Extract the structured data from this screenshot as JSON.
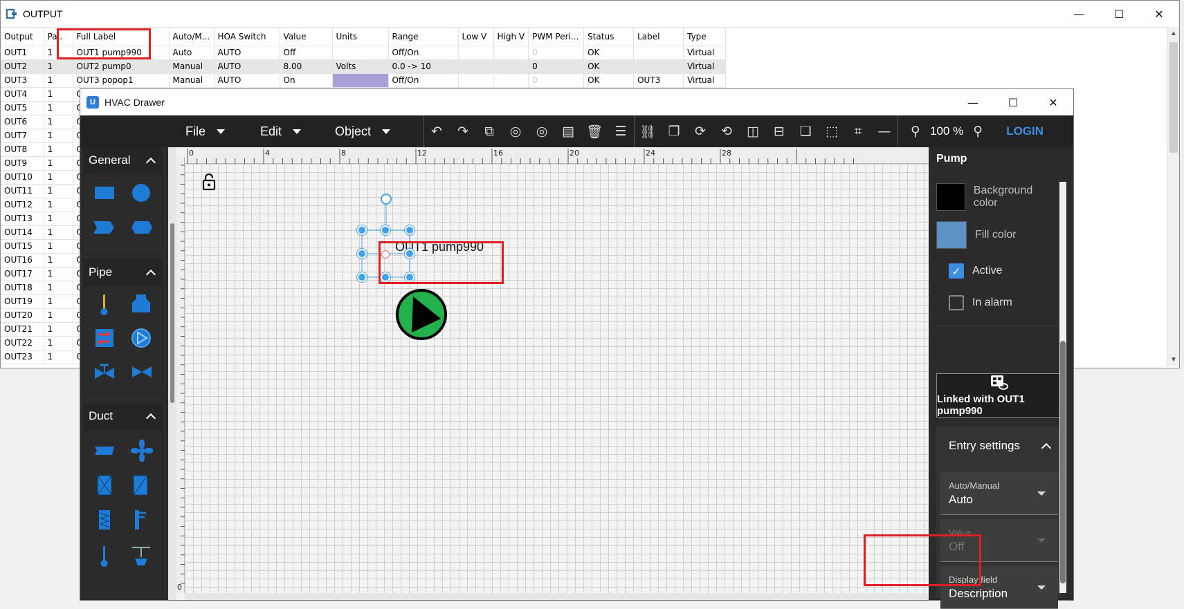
{
  "output_window": {
    "title": "OUTPUT",
    "controls": {
      "minimize": "—",
      "maximize": "☐",
      "close": "✕"
    },
    "columns": [
      "Output",
      "Pa..",
      "Full Label",
      "Auto/M...",
      "HOA Switch",
      "Value",
      "Units",
      "Range",
      "Low V",
      "High V",
      "PWM Peri...",
      "Status",
      "Label",
      "Type"
    ],
    "rows": [
      [
        "OUT1",
        "1",
        "OUT1 pump990",
        "Auto",
        "AUTO",
        "Off",
        "",
        "Off/On",
        "",
        "",
        "0",
        "OK",
        "",
        "Virtual"
      ],
      [
        "OUT2",
        "1",
        "OUT2 pump0",
        "Manual",
        "AUTO",
        "8.00",
        "Volts",
        "0.0 -> 10",
        "",
        "",
        "0",
        "OK",
        "",
        "Virtual"
      ],
      [
        "OUT3",
        "1",
        "OUT3 popop1",
        "Manual",
        "AUTO",
        "On",
        "",
        "Off/On",
        "",
        "",
        "0",
        "OK",
        "OUT3",
        "Virtual"
      ],
      [
        "OUT4",
        "1",
        "O"
      ],
      [
        "OUT5",
        "1",
        "O"
      ],
      [
        "OUT6",
        "1",
        "O"
      ],
      [
        "OUT7",
        "1",
        "O"
      ],
      [
        "OUT8",
        "1",
        "O"
      ],
      [
        "OUT9",
        "1",
        "O"
      ],
      [
        "OUT10",
        "1",
        "O"
      ],
      [
        "OUT11",
        "1",
        "O"
      ],
      [
        "OUT12",
        "1",
        "O"
      ],
      [
        "OUT13",
        "1",
        "O"
      ],
      [
        "OUT14",
        "1",
        "O"
      ],
      [
        "OUT15",
        "1",
        "O"
      ],
      [
        "OUT16",
        "1",
        "O"
      ],
      [
        "OUT17",
        "1",
        "O"
      ],
      [
        "OUT18",
        "1",
        "O"
      ],
      [
        "OUT19",
        "1",
        "O"
      ],
      [
        "OUT20",
        "1",
        "O"
      ],
      [
        "OUT21",
        "1",
        "O"
      ],
      [
        "OUT22",
        "1",
        "O"
      ],
      [
        "OUT23",
        "1",
        "O"
      ]
    ]
  },
  "hvac_window": {
    "title": "HVAC Drawer",
    "app_icon_letter": "U",
    "controls": {
      "minimize": "—",
      "maximize": "☐",
      "close": "✕"
    },
    "menus": [
      "File",
      "Edit",
      "Object"
    ],
    "toolbar_icons": [
      "undo-icon",
      "redo-icon",
      "copy-icon",
      "group-icon",
      "ungroup-icon",
      "duplicate-icon",
      "delete-icon",
      "align-icon",
      "link-icon",
      "paste-icon",
      "rotate-cw-icon",
      "rotate-ccw-icon",
      "flip-horizontal-icon",
      "flip-vertical-icon",
      "bring-front-icon",
      "send-back-icon",
      "crop-icon",
      "line-icon"
    ],
    "zoom": "100 %",
    "login": "LOGIN",
    "palette": {
      "sections": [
        "General",
        "Pipe",
        "Duct"
      ]
    },
    "ruler": {
      "h_labels": [
        "0",
        "4",
        "8",
        "12",
        "16",
        "20",
        "24",
        "28"
      ],
      "v_label": "0"
    },
    "canvas": {
      "pump_label": "OUT1 pump990"
    },
    "properties": {
      "title": "Pump",
      "background_color_label": "Background color",
      "background_color": "#000000",
      "fill_color_label": "Fill color",
      "fill_color": "#5d93c4",
      "active_label": "Active",
      "active_checked": true,
      "alarm_label": "In alarm",
      "alarm_checked": false,
      "linked_label": "Linked with OUT1 pump990",
      "entry_settings": "Entry settings",
      "fields": [
        {
          "label": "Auto/Manual",
          "value": "Auto",
          "disabled": false
        },
        {
          "label": "Value",
          "value": "Off",
          "disabled": true
        },
        {
          "label": "Display field",
          "value": "Description",
          "disabled": false
        }
      ]
    }
  },
  "colors": {
    "accent": "#3a8de0",
    "highlight_red": "#e02020",
    "pump_green": "#22b14c"
  }
}
